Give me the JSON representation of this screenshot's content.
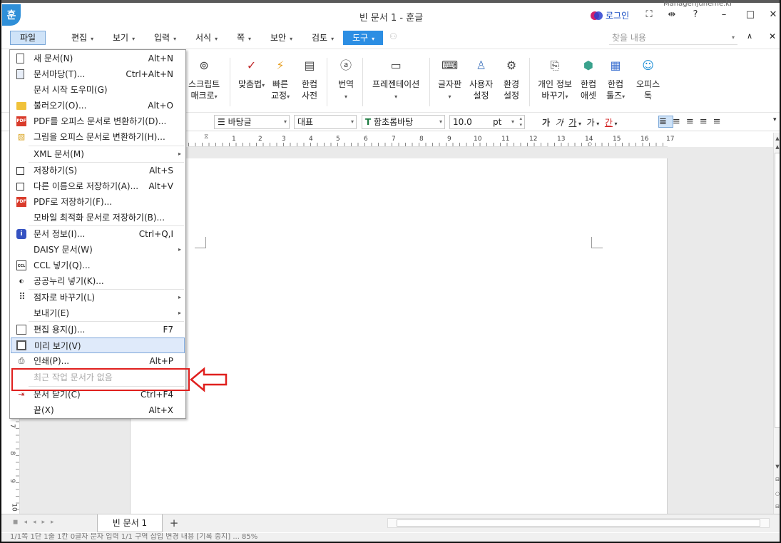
{
  "window": {
    "title": "빈 문서 1 - 훈글",
    "app_logo": "훈",
    "login_label": "로그인",
    "help_label": "?",
    "email_overlay": "Managerijuneme.kr"
  },
  "menubar": {
    "file": "파일",
    "items": [
      "편집",
      "보기",
      "입력",
      "서식",
      "쪽",
      "보안",
      "검토"
    ],
    "tools": "도구",
    "search_placeholder": "찾을 내용"
  },
  "ribbon": {
    "script_macro": [
      "스크립트",
      "매크로"
    ],
    "spellcheck": "맞춤법",
    "quick_correct": [
      "빠른",
      "교정"
    ],
    "dictionary": [
      "한컴",
      "사전"
    ],
    "translate": "번역",
    "presentation": "프레젠테이션",
    "keyboard": "글자판",
    "user_settings": [
      "사용자",
      "설정"
    ],
    "env_settings": [
      "환경",
      "설정"
    ],
    "personal_info": [
      "개인 정보",
      "바꾸기"
    ],
    "hancom_asset": [
      "한컴",
      "애셋"
    ],
    "hancom_tools": [
      "한컴",
      "툴즈"
    ],
    "office_talk": [
      "오피스",
      "톡"
    ]
  },
  "format_bar": {
    "style": "바탕글",
    "language": "대표",
    "font": "함초롬바탕",
    "size": "10.0",
    "unit": "pt",
    "font_icon": "T"
  },
  "ruler": {
    "h_numbers": [
      "1",
      "2",
      "3",
      "4",
      "5",
      "6",
      "7",
      "8",
      "9",
      "10",
      "11",
      "12",
      "13",
      "14",
      "15",
      "16",
      "17"
    ],
    "v_numbers": [
      "7",
      "8",
      "9",
      "10"
    ]
  },
  "file_menu": {
    "items": [
      {
        "label": "새 문서(N)",
        "shortcut": "Alt+N",
        "icon": "new-doc-icon"
      },
      {
        "label": "문서마당(T)...",
        "shortcut": "Ctrl+Alt+N",
        "icon": "template-icon"
      },
      {
        "label": "문서 시작 도우미(G)",
        "shortcut": "",
        "icon": ""
      },
      {
        "label": "불러오기(O)...",
        "shortcut": "Alt+O",
        "icon": "folder-icon"
      },
      {
        "label": "PDF를 오피스 문서로 변환하기(D)...",
        "shortcut": "",
        "icon": "pdf-icon"
      },
      {
        "label": "그림을 오피스 문서로 변환하기(H)...",
        "shortcut": "",
        "icon": "image-icon"
      },
      {
        "label": "XML 문서(M)",
        "shortcut": "",
        "icon": ""
      },
      {
        "label": "저장하기(S)",
        "shortcut": "Alt+S",
        "icon": "save-icon"
      },
      {
        "label": "다른 이름으로 저장하기(A)...",
        "shortcut": "Alt+V",
        "icon": "save-as-icon"
      },
      {
        "label": "PDF로 저장하기(F)...",
        "shortcut": "",
        "icon": "pdf-save-icon"
      },
      {
        "label": "모바일 최적화 문서로 저장하기(B)...",
        "shortcut": "",
        "icon": ""
      },
      {
        "label": "문서 정보(I)...",
        "shortcut": "Ctrl+Q,I",
        "icon": "info-icon"
      },
      {
        "label": "DAISY 문서(W)",
        "shortcut": "",
        "icon": ""
      },
      {
        "label": "CCL 넣기(Q)...",
        "shortcut": "",
        "icon": "ccl-icon"
      },
      {
        "label": "공공누리 넣기(K)...",
        "shortcut": "",
        "icon": "kogl-icon"
      },
      {
        "label": "점자로 바꾸기(L)",
        "shortcut": "",
        "icon": "braille-icon"
      },
      {
        "label": "보내기(E)",
        "shortcut": "",
        "icon": ""
      },
      {
        "label": "편집 용지(J)...",
        "shortcut": "F7",
        "icon": "page-setup-icon"
      },
      {
        "label": "미리 보기(V)",
        "shortcut": "",
        "icon": "preview-icon"
      },
      {
        "label": "인쇄(P)...",
        "shortcut": "Alt+P",
        "icon": "print-icon"
      },
      {
        "label": "최근 작업 문서가 없음",
        "shortcut": "",
        "icon": ""
      },
      {
        "label": "문서 닫기(C)",
        "shortcut": "Ctrl+F4",
        "icon": "close-doc-icon"
      },
      {
        "label": "끝(X)",
        "shortcut": "Alt+X",
        "icon": ""
      }
    ]
  },
  "tabs": {
    "doc_tab": "빈 문서 1",
    "add": "+"
  },
  "statusbar": {
    "text": "1/1쪽   1단   1줄   1칸   0글자   문자 입력   1/1 구역   삽입   변경 내용 [기록 중지]   ...   85%"
  },
  "colors": {
    "accent": "#2c8ee3",
    "highlight_box": "#e0201e",
    "menu_hover": "#dfeafa"
  }
}
